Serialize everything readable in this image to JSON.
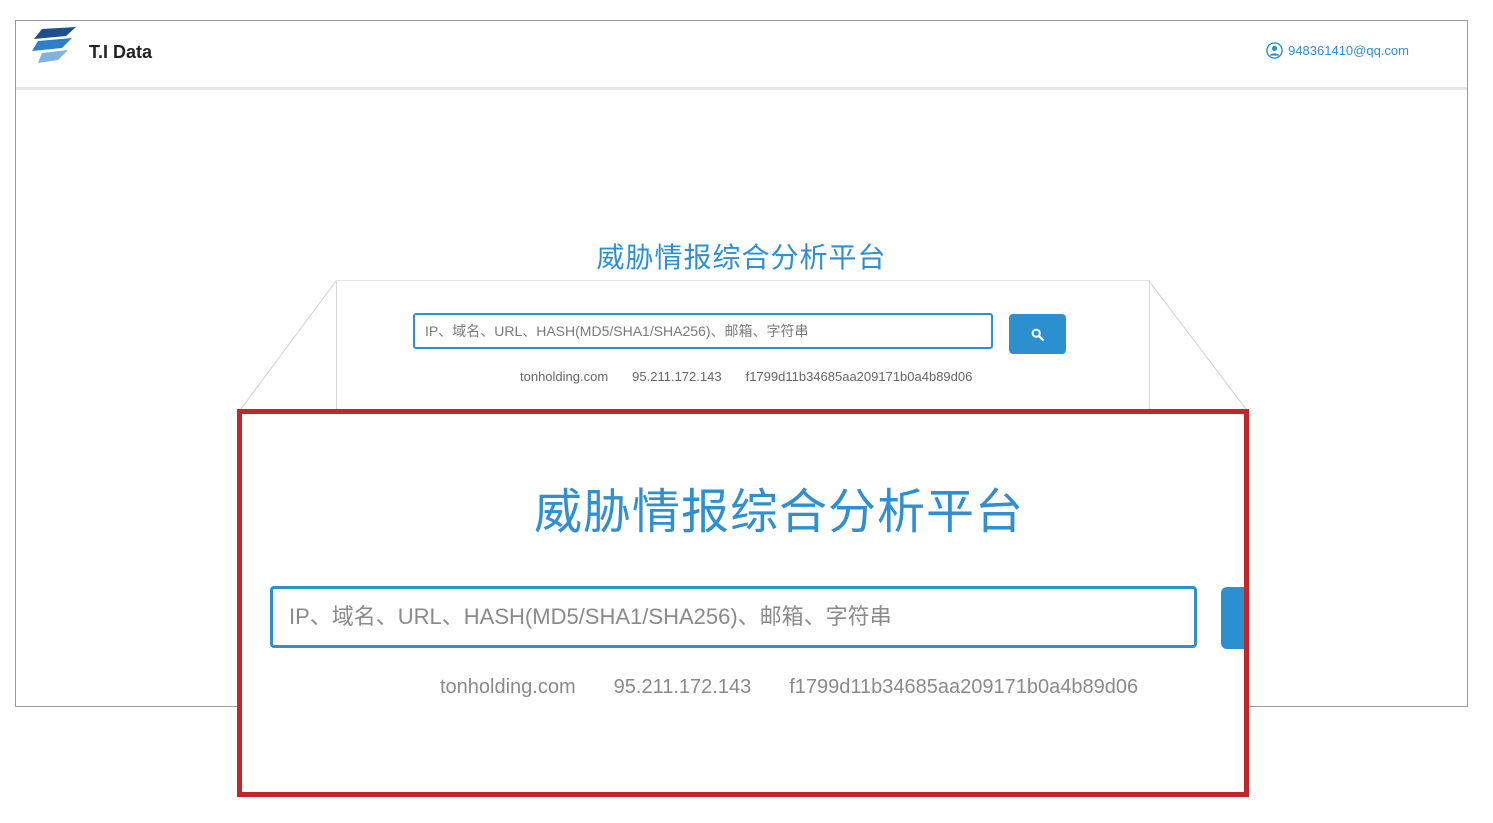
{
  "header": {
    "brand": "T.I Data",
    "user_email": "948361410@qq.com"
  },
  "main": {
    "title": "威胁情报综合分析平台",
    "search": {
      "placeholder": "IP、域名、URL、HASH(MD5/SHA1/SHA256)、邮箱、字符串",
      "button_icon": "search-icon"
    },
    "examples": [
      "tonholding.com",
      "95.211.172.143",
      "f1799d11b34685aa209171b0a4b89d06"
    ]
  },
  "zoom": {
    "title": "威胁情报综合分析平台",
    "placeholder": "IP、域名、URL、HASH(MD5/SHA1/SHA256)、邮箱、字符串",
    "examples": [
      "tonholding.com",
      "95.211.172.143",
      "f1799d11b34685aa209171b0a4b89d06"
    ]
  },
  "colors": {
    "accent": "#2f8fcf",
    "highlight_border": "#c4252a"
  }
}
